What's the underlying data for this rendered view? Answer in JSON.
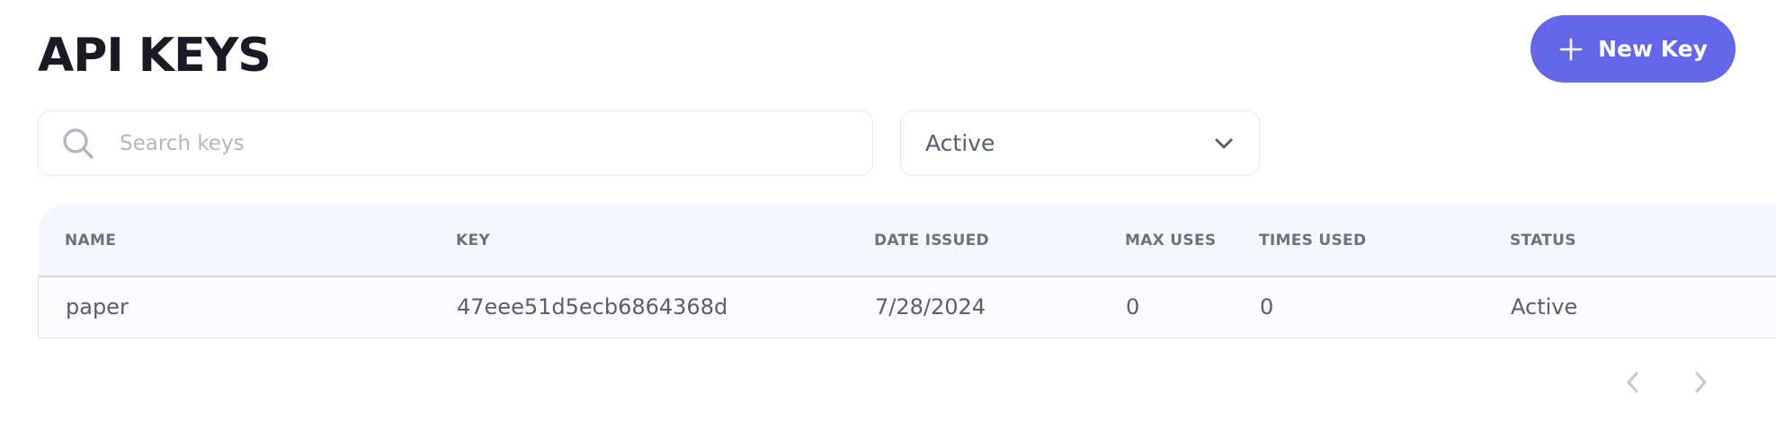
{
  "header": {
    "title": "API KEYS",
    "new_key_label": "New Key"
  },
  "filters": {
    "search_placeholder": "Search keys",
    "search_value": "",
    "status_selected": "Active"
  },
  "table": {
    "columns": [
      "NAME",
      "KEY",
      "DATE ISSUED",
      "MAX USES",
      "TIMES USED",
      "STATUS"
    ],
    "rows": [
      {
        "name": "paper",
        "key": "47eee51d5ecb6864368d",
        "date_issued": "7/28/2024",
        "max_uses": "0",
        "times_used": "0",
        "status": "Active"
      }
    ]
  },
  "icons": {
    "add": "plus-icon",
    "search": "search-icon",
    "dropdown": "chevron-down-icon",
    "previous": "chevron-left-icon",
    "next": "chevron-right-icon"
  },
  "colors": {
    "accent": "#6466e8",
    "title": "#1a1a27",
    "header_bg": "#f6f7fd",
    "muted_text": "#5a5d6c",
    "disabled_icon": "#c4c6d0"
  }
}
